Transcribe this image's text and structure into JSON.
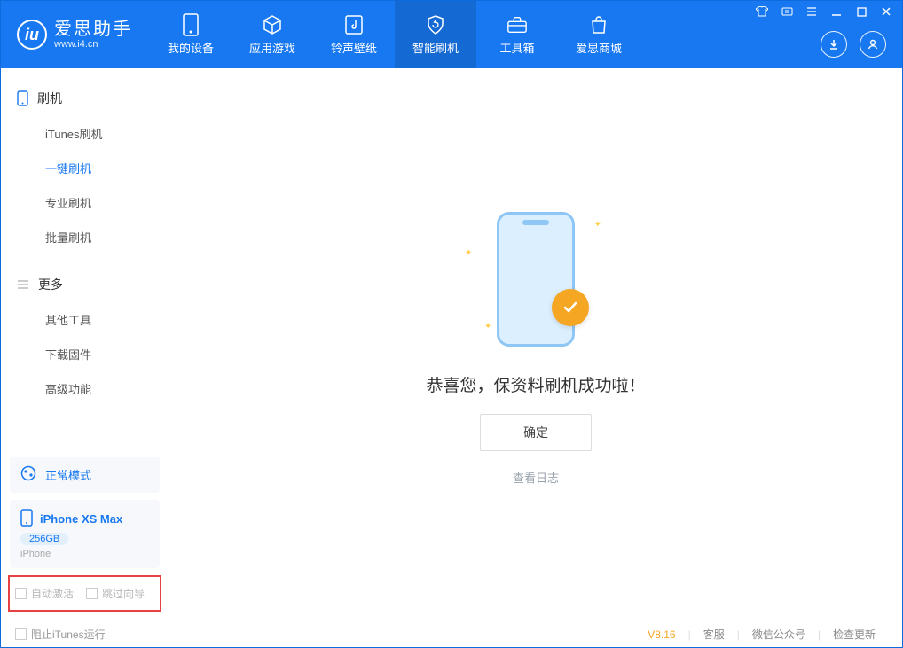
{
  "brand": {
    "title": "爱思助手",
    "subtitle": "www.i4.cn"
  },
  "header_tabs": [
    {
      "label": "我的设备"
    },
    {
      "label": "应用游戏"
    },
    {
      "label": "铃声壁纸"
    },
    {
      "label": "智能刷机",
      "active": true
    },
    {
      "label": "工具箱"
    },
    {
      "label": "爱思商城"
    }
  ],
  "sidebar": {
    "section1_title": "刷机",
    "section1_items": [
      {
        "label": "iTunes刷机"
      },
      {
        "label": "一键刷机",
        "active": true
      },
      {
        "label": "专业刷机"
      },
      {
        "label": "批量刷机"
      }
    ],
    "section2_title": "更多",
    "section2_items": [
      {
        "label": "其他工具"
      },
      {
        "label": "下载固件"
      },
      {
        "label": "高级功能"
      }
    ],
    "mode_label": "正常模式",
    "device": {
      "name": "iPhone XS Max",
      "capacity": "256GB",
      "type": "iPhone"
    },
    "opt_auto_activate": "自动激活",
    "opt_skip_guide": "跳过向导"
  },
  "main": {
    "success_text": "恭喜您，保资料刷机成功啦！",
    "ok_button": "确定",
    "view_log": "查看日志"
  },
  "footer": {
    "block_itunes": "阻止iTunes运行",
    "version": "V8.16",
    "links": [
      "客服",
      "微信公众号",
      "检查更新"
    ]
  }
}
